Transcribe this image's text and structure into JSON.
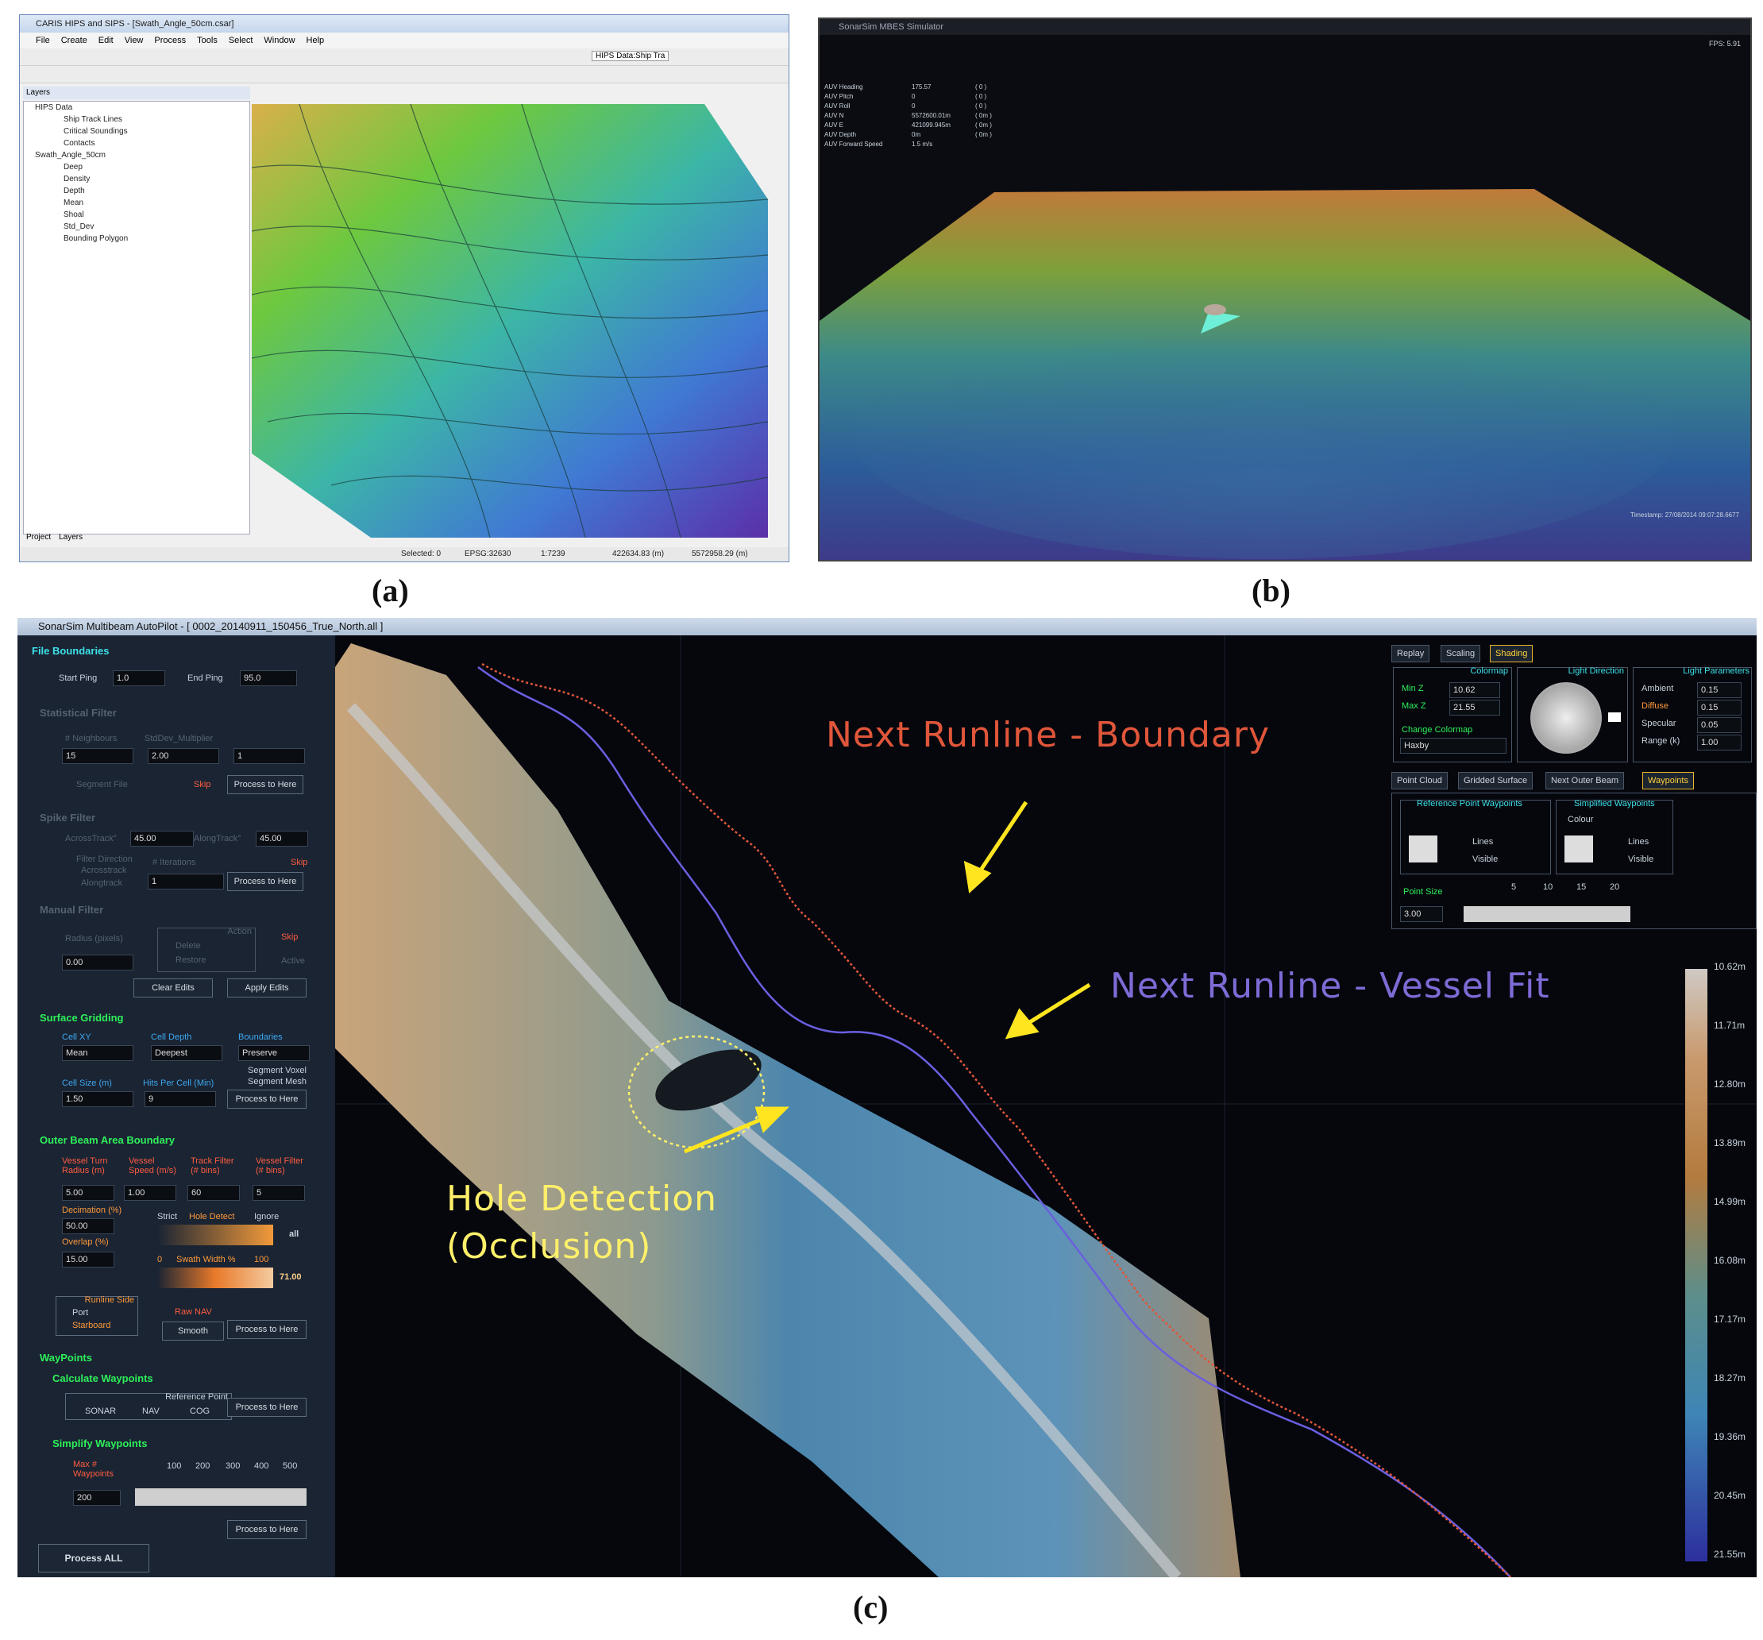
{
  "captions": {
    "a": "(a)",
    "b": "(b)",
    "c": "(c)"
  },
  "panel_a": {
    "window_title": "CARIS HIPS and SIPS - [Swath_Angle_50cm.csar]",
    "menu": [
      "File",
      "Create",
      "Edit",
      "View",
      "Process",
      "Tools",
      "Select",
      "Window",
      "Help"
    ],
    "toolbar_combo": "HIPS Data:Ship Tra",
    "layers_title": "Layers",
    "tree": [
      "HIPS Data",
      "Ship Track Lines",
      "Critical Soundings",
      "Contacts",
      "Swath_Angle_50cm",
      "Deep",
      "Density",
      "Depth",
      "Mean",
      "Shoal",
      "Std_Dev",
      "Bounding Polygon"
    ],
    "tabs": [
      "Project",
      "Layers"
    ],
    "status": [
      "Selected: 0",
      "EPSG:32630",
      "1:7239",
      "422634.83 (m)",
      "5572958.29 (m)"
    ]
  },
  "panel_b": {
    "window_title": "SonarSim MBES Simulator",
    "fps": "FPS:    5.91",
    "hud_labels": [
      "AUV Heading",
      "AUV Pitch",
      "AUV Roll",
      "AUV N",
      "AUV E",
      "AUV Depth",
      "AUV Forward Speed"
    ],
    "hud_values": [
      "175.57",
      "0",
      "0",
      "5572600.01m",
      "421099.945m",
      "0m",
      "1.5 m/s"
    ],
    "hud_units": [
      "( 0 )",
      "( 0 )",
      "( 0 )",
      "( 0m )",
      "( 0m )",
      "( 0m )",
      ""
    ],
    "timestamp": "Timestamp: 27/08/2014    09:07:28.6677"
  },
  "panel_c": {
    "window_title": "SonarSim Multibeam AutoPilot - [ 0002_20140911_150456_True_North.all ]",
    "file_boundaries": {
      "title": "File Boundaries",
      "start_label": "Start Ping",
      "start": "1.0",
      "end_label": "End Ping",
      "end": "95.0"
    },
    "statistical_filter": {
      "title": "Statistical Filter",
      "neigh_label": "# Neighbours",
      "neigh": "15",
      "std_label": "StdDev_Multiplier",
      "std": "2.00",
      "third": "1",
      "segment": "Segment File",
      "skip": "Skip",
      "process": "Process to Here"
    },
    "spike_filter": {
      "title": "Spike Filter",
      "across_label": "AcrossTrack°",
      "across": "45.00",
      "along_label": "AlongTrack°",
      "along": "45.00",
      "dir_label": "Filter Direction",
      "acrosstrack": "Acrosstrack",
      "alongtrack": "Alongtrack",
      "iter_label": "# Iterations",
      "iter": "1",
      "skip": "Skip",
      "process": "Process to Here"
    },
    "manual_filter": {
      "title": "Manual Filter",
      "radius_label": "Radius (pixels)",
      "radius": "0.00",
      "action": "Action",
      "delete": "Delete",
      "restore": "Restore",
      "skip": "Skip",
      "active": "Active",
      "clear": "Clear Edits",
      "apply": "Apply Edits"
    },
    "surface_gridding": {
      "title": "Surface Gridding",
      "cellxy_label": "Cell XY",
      "cellxy": "Mean",
      "celldepth_label": "Cell Depth",
      "celldepth": "Deepest",
      "bound_label": "Boundaries",
      "bound": "Preserve",
      "seg_voxel": "Segment Voxel",
      "seg_mesh": "Segment Mesh",
      "cellsize_label": "Cell Size (m)",
      "cellsize": "1.50",
      "hits_label": "Hits Per Cell (Min)",
      "hits": "9",
      "process": "Process to Here"
    },
    "outer_beam": {
      "title": "Outer Beam Area Boundary",
      "turn_label": "Vessel Turn Radius (m)",
      "turn": "5.00",
      "speed_label": "Vessel Speed (m/s)",
      "speed": "1.00",
      "track_label": "Track Filter (# bins)",
      "track": "60",
      "vfilter_label": "Vessel Filter (# bins)",
      "vfilter": "5",
      "decim_label": "Decimation (%)",
      "decim": "50.00",
      "overlap_label": "Overlap (%)",
      "overlap": "15.00",
      "strict": "Strict",
      "hole": "Hole Detect",
      "ignore": "Ignore",
      "all": "all",
      "sw_zero": "0",
      "sw_label": "Swath Width %",
      "sw_hundred": "100",
      "sw_value": "71.00",
      "runline_side": "Runline Side",
      "port": "Port",
      "starboard": "Starboard",
      "raw_nav": "Raw NAV",
      "smooth": "Smooth",
      "process": "Process to Here"
    },
    "waypoints": {
      "title": "WayPoints",
      "calc": "Calculate Waypoints",
      "ref_point": "Reference Point",
      "sonar": "SONAR",
      "nav": "NAV",
      "cog": "COG",
      "process1": "Process to Here",
      "simplify": "Simplify Waypoints",
      "max_label": "Max # Waypoints",
      "max": "200",
      "ticks": [
        "100",
        "200",
        "300",
        "400",
        "500"
      ],
      "process2": "Process to Here"
    },
    "process_all": "Process ALL",
    "view_tabs": [
      "Replay",
      "Scaling",
      "Shading"
    ],
    "colormap": {
      "title": "Colormap",
      "minz_label": "Min Z",
      "minz": "10.62",
      "maxz_label": "Max Z",
      "maxz": "21.55",
      "change": "Change Colormap",
      "map": "Haxby"
    },
    "light_direction": "Light Direction",
    "light_params": {
      "title": "Light Parameters",
      "ambient_label": "Ambient",
      "ambient": "0.15",
      "diffuse_label": "Diffuse",
      "diffuse": "0.15",
      "specular_label": "Specular",
      "specular": "0.05",
      "range_label": "Range (k)",
      "range": "1.00"
    },
    "layer_tabs": [
      "Point Cloud",
      "Gridded Surface",
      "Next Outer Beam",
      "Waypoints"
    ],
    "ref_waypoints": {
      "title": "Reference Point Waypoints",
      "lines": "Lines",
      "visible": "Visible"
    },
    "simp_waypoints": {
      "title": "Simplified Waypoints",
      "colour": "Colour",
      "lines": "Lines",
      "visible": "Visible"
    },
    "point_size": {
      "label": "Point Size",
      "value": "3.00",
      "ticks": [
        "5",
        "10",
        "15",
        "20"
      ]
    },
    "depth_scale": [
      "10.62m",
      "11.71m",
      "12.80m",
      "13.89m",
      "14.99m",
      "16.08m",
      "17.17m",
      "18.27m",
      "19.36m",
      "20.45m",
      "21.55m"
    ],
    "annotations": {
      "boundary": "Next Runline - Boundary",
      "vessel": "Next Runline - Vessel Fit",
      "hole1": "Hole Detection",
      "hole2": "(Occlusion)"
    },
    "colors": {
      "boundary": "#e0563a",
      "vessel": "#7e6bd6",
      "hole": "#fff06a",
      "panel": "#1a2433",
      "accent": "#3ee0e8"
    }
  }
}
